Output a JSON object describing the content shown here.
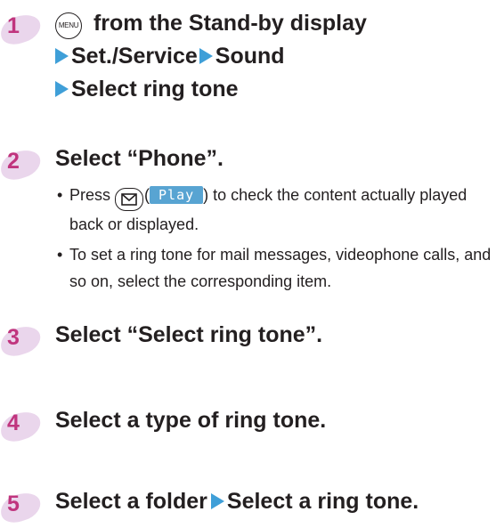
{
  "steps": [
    {
      "number": "1",
      "key_label": "MENU",
      "line1_text": " from the Stand-by display",
      "line2_a": "Set./Service",
      "line2_b": "Sound",
      "line3": "Select ring tone"
    },
    {
      "number": "2",
      "title": "Select “Phone”.",
      "bullet_dot": "•",
      "bullet1_pre": "Press ",
      "bullet1_paren_open": "(",
      "softkey_label": "Play",
      "bullet1_post": ") to check the content actually played back or displayed.",
      "bullet2": "To set a ring tone for mail messages, videophone calls, and so on, select the corresponding item."
    },
    {
      "number": "3",
      "title": "Select “Select ring tone”."
    },
    {
      "number": "4",
      "title": "Select a type of ring tone."
    },
    {
      "number": "5",
      "title_a": "Select a folder",
      "title_b": "Select a ring tone."
    }
  ],
  "colors": {
    "step_number": "#c0357e",
    "step_blob": "#ead6ec",
    "arrow": "#3f9fd8",
    "softkey_bg": "#58a4d2"
  },
  "icons": [
    "menu-key-icon",
    "mail-key-icon",
    "arrow-icon"
  ]
}
